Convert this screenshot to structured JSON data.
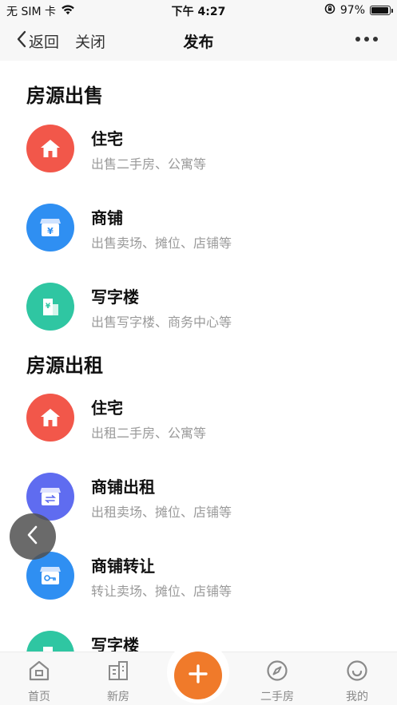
{
  "status_bar": {
    "carrier": "无 SIM 卡",
    "time": "下午 4:27",
    "battery_text": "97%",
    "battery_level": 0.97
  },
  "nav": {
    "back_label": "返回",
    "close_label": "关闭",
    "title": "发布"
  },
  "sections": [
    {
      "title": "房源出售",
      "items": [
        {
          "title": "住宅",
          "subtitle": "出售二手房、公寓等",
          "icon": "house-icon",
          "color": "#f2574a"
        },
        {
          "title": "商铺",
          "subtitle": "出售卖场、摊位、店铺等",
          "icon": "shop-yen-icon",
          "color": "#2f8ff2"
        },
        {
          "title": "写字楼",
          "subtitle": "出售写字楼、商务中心等",
          "icon": "office-building-icon",
          "color": "#2fc6a2"
        }
      ]
    },
    {
      "title": "房源出租",
      "items": [
        {
          "title": "住宅",
          "subtitle": "出租二手房、公寓等",
          "icon": "house-icon",
          "color": "#f2574a"
        },
        {
          "title": "商铺出租",
          "subtitle": "出租卖场、摊位、店铺等",
          "icon": "shop-exchange-icon",
          "color": "#5f6cf0"
        },
        {
          "title": "商铺转让",
          "subtitle": "转让卖场、摊位、店铺等",
          "icon": "shop-key-icon",
          "color": "#2f8ff2"
        },
        {
          "title": "写字楼",
          "subtitle": "",
          "icon": "office-building-icon",
          "color": "#2fc6a2"
        }
      ]
    }
  ],
  "tabbar": {
    "tabs": [
      {
        "label": "首页",
        "icon": "home-tab-icon"
      },
      {
        "label": "新房",
        "icon": "building-tab-icon"
      },
      {
        "label": "二手房",
        "icon": "compass-tab-icon"
      },
      {
        "label": "我的",
        "icon": "smile-tab-icon"
      }
    ],
    "fab_icon": "plus-icon",
    "fab_color": "#f07a2a"
  }
}
